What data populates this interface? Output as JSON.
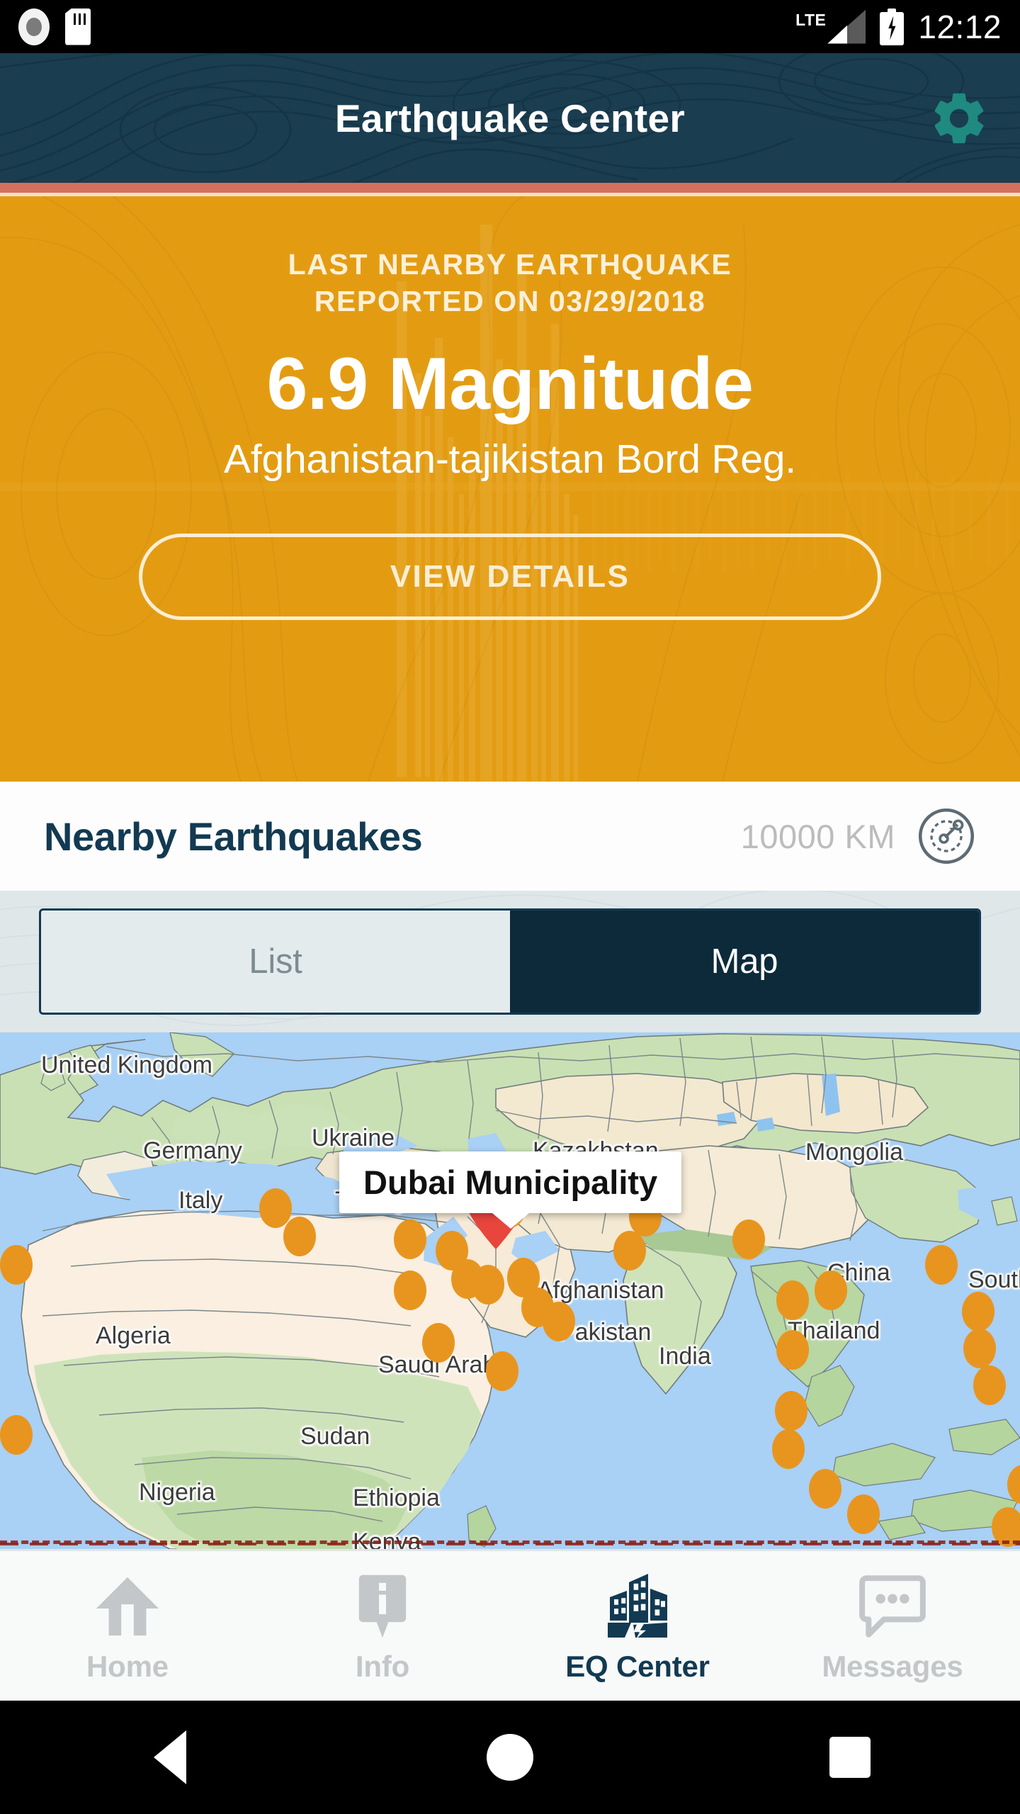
{
  "status_bar": {
    "time": "12:12",
    "network": "LTE",
    "icons": [
      "record-icon",
      "sd-card-icon",
      "signal-icon",
      "battery-charging-icon"
    ]
  },
  "header": {
    "title": "Earthquake Center",
    "settings_icon": "gear-icon",
    "background_color": "#1b3d50",
    "accent_color": "#d4705e"
  },
  "hero": {
    "kicker_line1": "LAST NEARBY EARTHQUAKE",
    "kicker_line2": "REPORTED ON 03/29/2018",
    "magnitude": "6.9 Magnitude",
    "magnitude_value": "6.9",
    "region": "Afghanistan-tajikistan Bord Reg.",
    "cta_label": "VIEW DETAILS",
    "background_color": "#e39c12",
    "text_color": "#ffffff"
  },
  "nearby": {
    "title": "Nearby Earthquakes",
    "radius": "10000 KM",
    "radar_icon": "radar-radius-icon"
  },
  "tabs": {
    "items": [
      {
        "label": "List",
        "active": false
      },
      {
        "label": "Map",
        "active": true
      }
    ],
    "active_color": "#0c2a3a",
    "inactive_color": "#e4ebed"
  },
  "map": {
    "info_window": "Dubai Municipality",
    "marker_icon": "map-pin-icon",
    "marker_color": "#e8453c",
    "quake_dot_color": "#e8951f",
    "water_color": "#a9d0f5",
    "country_labels": [
      "United Kingdom",
      "Germany",
      "Ukraine",
      "Italy",
      "Turkey",
      "Kazakhstan",
      "Mongolia",
      "China",
      "South K",
      "Afghanistan",
      "Pakistan",
      "India",
      "Saudi Arabia",
      "Algeria",
      "Sudan",
      "Nigeria",
      "Ethiopia",
      "Kenya",
      "Thailand"
    ]
  },
  "bottom_nav": {
    "items": [
      {
        "label": "Home",
        "icon": "home-icon",
        "active": false
      },
      {
        "label": "Info",
        "icon": "info-pin-icon",
        "active": false
      },
      {
        "label": "EQ Center",
        "icon": "broken-buildings-icon",
        "active": true
      },
      {
        "label": "Messages",
        "icon": "chat-bubble-icon",
        "active": false
      }
    ],
    "active_color": "#123a52",
    "inactive_color": "#c3c7c9"
  },
  "system_nav": {
    "back": "back-triangle-icon",
    "home": "home-circle-icon",
    "recents": "recents-square-icon"
  }
}
